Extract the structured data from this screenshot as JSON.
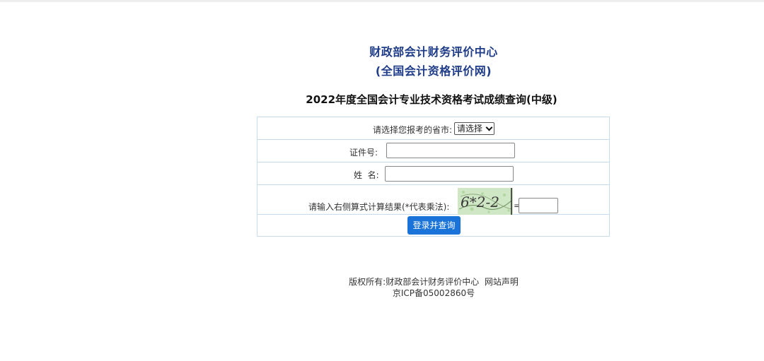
{
  "header": {
    "org_name": "财政部会计财务评价中心",
    "org_subtitle": "(全国会计资格评价网)",
    "exam_title": "2022年度全国会计专业技术资格考试成绩查询(中级)"
  },
  "form": {
    "province_label": "请选择您报考的省市:",
    "province_selected": "请选择",
    "id_label": "证件号:",
    "id_value": "",
    "name_label": "姓  名:",
    "name_value": "",
    "captcha_label": "请输入右侧算式计算结果(*代表乘法):",
    "captcha_text": "6*2-2",
    "captcha_equals": "=",
    "captcha_value": "",
    "submit_label": "登录并查询"
  },
  "footer": {
    "copyright_prefix": "版权所有:",
    "copyright_owner": "财政部会计财务评价中心",
    "site_statement": "网站声明",
    "icp": "京ICP备05002860号"
  },
  "colors": {
    "title_blue": "#1f3c88",
    "button_blue": "#1a73d9",
    "table_border": "#c7dcef"
  }
}
